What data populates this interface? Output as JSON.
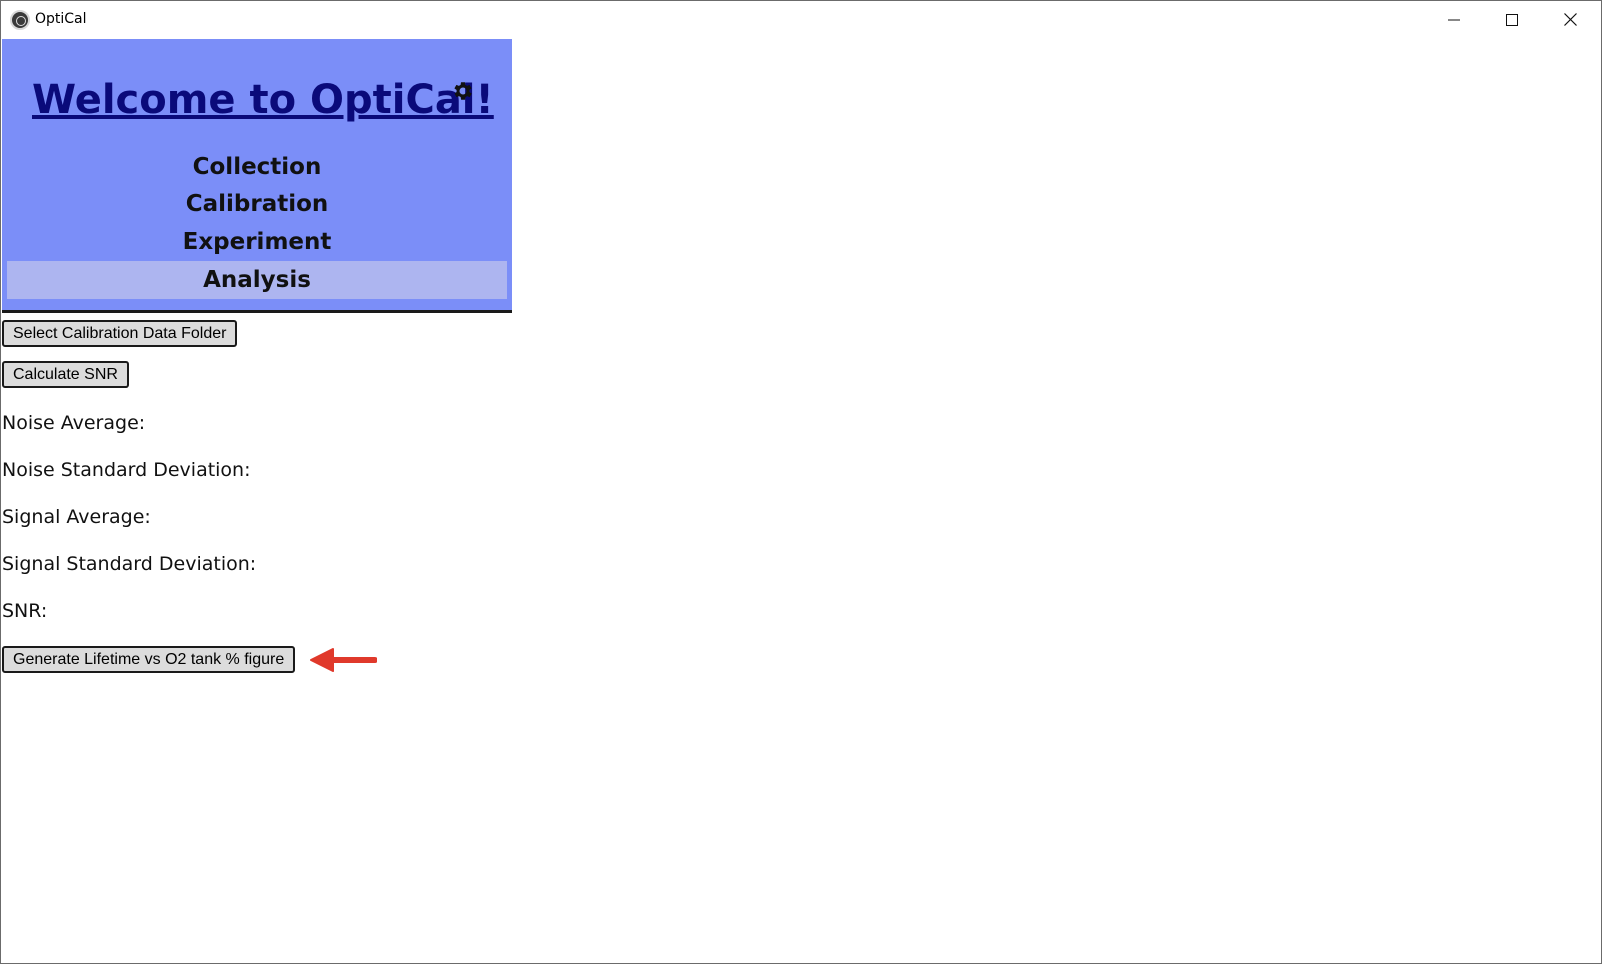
{
  "window": {
    "title": "OptiCal"
  },
  "header": {
    "welcome_title": "Welcome to OptiCal!",
    "settings_icon": "gear-icon"
  },
  "nav": {
    "items": [
      {
        "label": "Collection",
        "active": false
      },
      {
        "label": "Calibration",
        "active": false
      },
      {
        "label": "Experiment",
        "active": false
      },
      {
        "label": "Analysis",
        "active": true
      }
    ]
  },
  "actions": {
    "select_folder_label": "Select Calibration Data Folder",
    "calculate_snr_label": "Calculate SNR",
    "generate_figure_label": "Generate Lifetime vs O2 tank % figure"
  },
  "results": {
    "noise_average_label": "Noise Average:",
    "noise_std_label": "Noise Standard Deviation:",
    "signal_average_label": "Signal Average:",
    "signal_std_label": "Signal Standard Deviation:",
    "snr_label": "SNR:"
  },
  "colors": {
    "header_bg": "#7b8ef8",
    "active_nav_bg": "#adb5f0",
    "title_color": "#0a0a7a",
    "arrow_color": "#e0392b"
  }
}
